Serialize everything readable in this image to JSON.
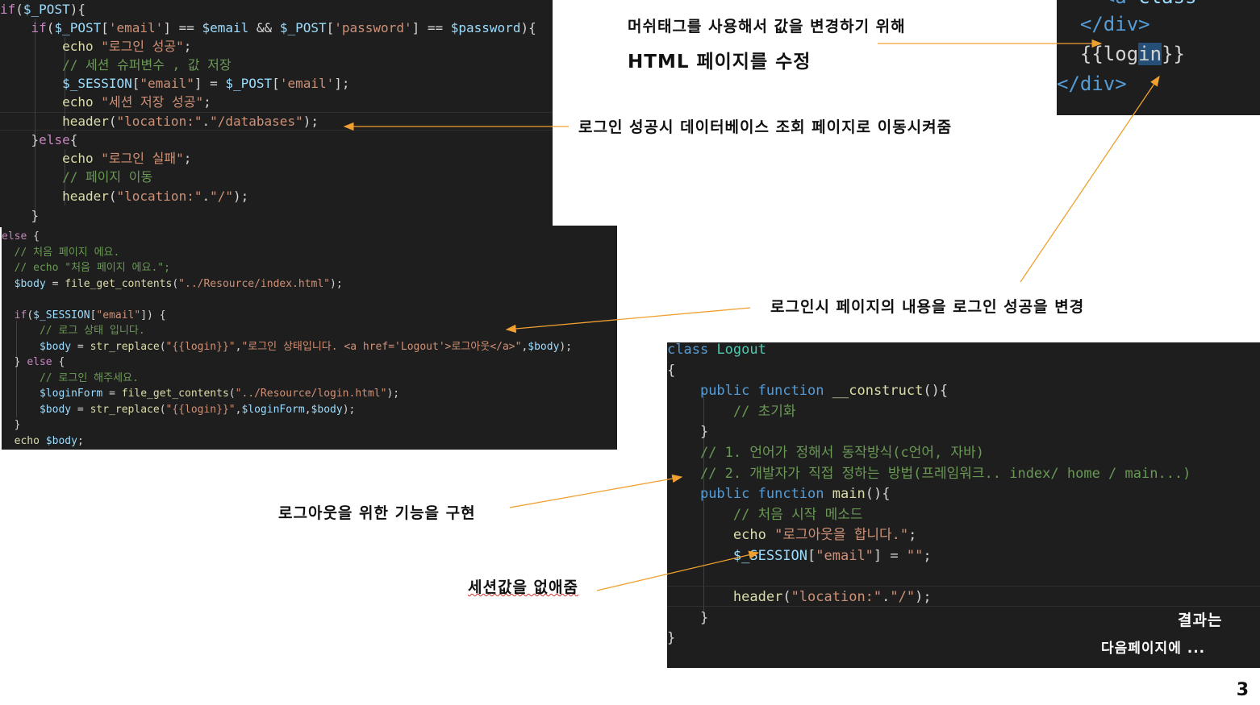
{
  "code_php_login": [
    "if($_POST){",
    "    if($_POST['email'] == $email && $_POST['password'] == $password){",
    "        echo \"로그인 성공\";",
    "        // 세션 슈퍼변수 , 값 저장",
    "        $_SESSION[\"email\"] = $_POST['email'];",
    "        echo \"세션 저장 성공\";",
    "        header(\"location:\".\"/databases\");",
    "    }else{",
    "        echo \"로그인 실패\";",
    "        // 페이지 이동",
    "        header(\"location:\".\"/\");",
    "    }"
  ],
  "code_php_else": [
    "else {",
    "  // 처음 페이지 에요.",
    "  // echo \"처음 페이지 에요.\";",
    "  $body = file_get_contents(\"../Resource/index.html\");",
    "",
    "  if($_SESSION[\"email\"]) {",
    "      // 로그 상태 입니다.",
    "      $body = str_replace(\"{{login}}\",\"로그인 상태입니다. <a href='Logout'>로그아웃</a>\",$body);",
    "  } else {",
    "      // 로그인 해주세요.",
    "      $loginForm = file_get_contents(\"../Resource/login.html\");",
    "      $body = str_replace(\"{{login}}\",$loginForm,$body);",
    "  }",
    "  echo $body;"
  ],
  "code_html_snippet": [
    "    <a class",
    "  </div>",
    "  {{login}}",
    "</div>"
  ],
  "code_logout_class": [
    "class Logout",
    "{",
    "    public function __construct(){",
    "        // 초기화",
    "    }",
    "    // 1. 언어가 정해서 동작방식(c언어, 자바)",
    "    // 2. 개발자가 직접 정하는 방법(프레임워크.. index/ home / main...)",
    "    public function main(){",
    "        // 처음 시작 메소드",
    "        echo \"로그아웃을 합니다.\";",
    "        $_SESSION[\"email\"] = \"\";",
    "",
    "        header(\"location:\".\"/\");",
    "    }",
    "}"
  ],
  "annotations": {
    "mustache_line1": "머쉬태그를 사용해서 값을 변경하기 위해",
    "mustache_line2": "HTML 페이지를 수정",
    "login_redirect": "로그인 성공시 데이터베이스 조회 페이지로 이동시켜줌",
    "login_content": "로그인시 페이지의 내용을 로그인 성공을 변경",
    "logout_feature": "로그아웃을 위한 기능을 구현",
    "session_clear": "세션값을 없애줌",
    "result_line1": "결과는",
    "result_line2": "다음페이지에 ..."
  },
  "page_number": "3",
  "colors": {
    "arrow": "#f0a030",
    "code_bg": "#1e1e1e",
    "keyword": "#569cd6",
    "string": "#ce9178",
    "comment": "#6a9955"
  }
}
